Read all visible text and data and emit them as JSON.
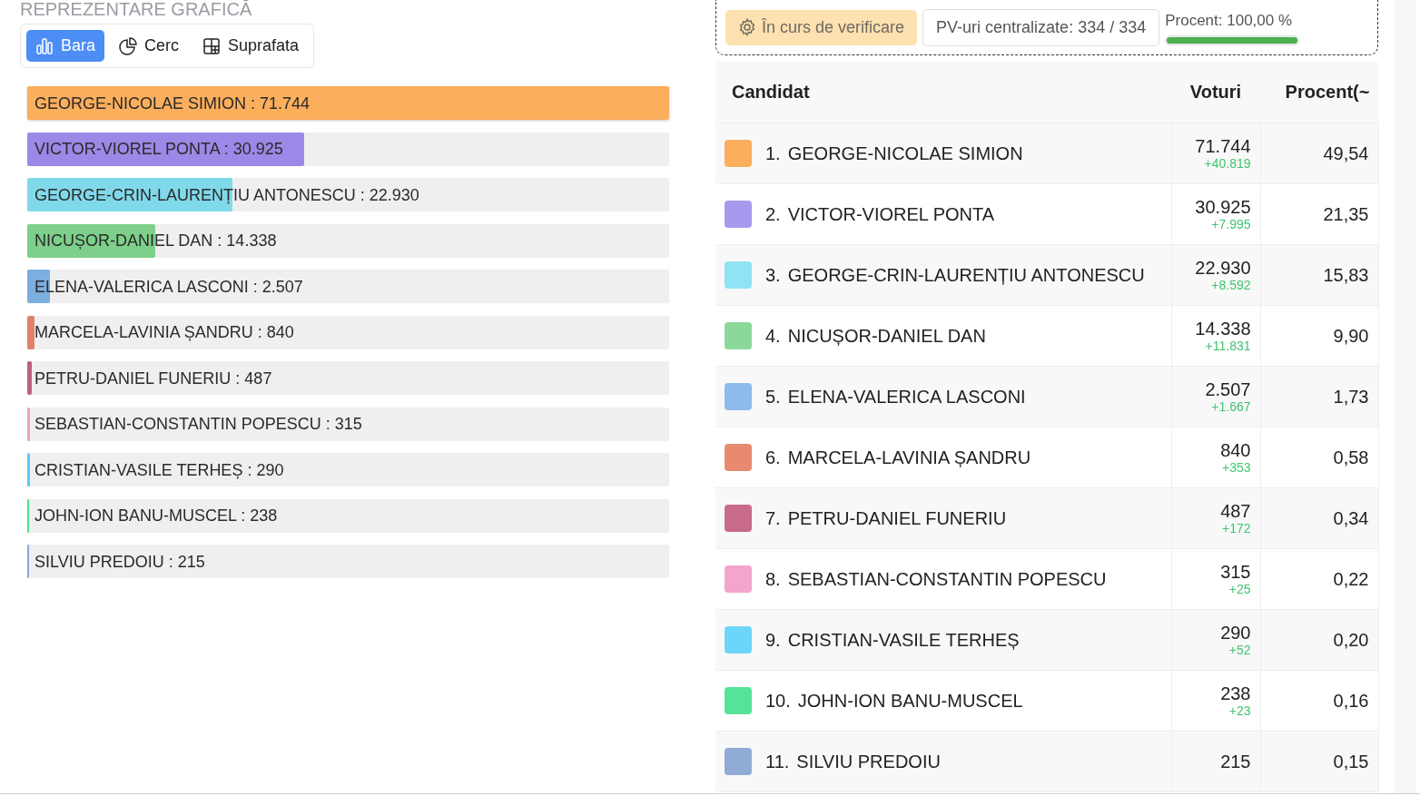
{
  "chart_section": {
    "title": "REPREZENTARE GRAFICĂ",
    "view_tabs": [
      {
        "label": "Bara",
        "kind": "bar",
        "selected": true
      },
      {
        "label": "Cerc",
        "kind": "pie",
        "selected": false
      },
      {
        "label": "Suprafata",
        "kind": "grid",
        "selected": false
      }
    ],
    "bars": [
      {
        "label": "GEORGE-NICOLAE SIMION : 71.744",
        "level": 1,
        "color": "#fbae5c"
      },
      {
        "label": "VICTOR-VIOREL PONTA : 30.925",
        "level": 0.431,
        "color": "#9c88e6"
      },
      {
        "label": "GEORGE-CRIN-LAURENȚIU ANTONESCU : 22.930",
        "level": 0.32,
        "color": "#80d9ea"
      },
      {
        "label": "NICUȘOR-DANIEL DAN : 14.338",
        "level": 0.2,
        "color": "#7dcf8a"
      },
      {
        "label": "ELENA-VALERICA LASCONI : 2.507",
        "level": 0.035,
        "color": "#7daee0"
      },
      {
        "label": "MARCELA-LAVINIA ȘANDRU : 840",
        "level": 0.0117,
        "color": "#e0826a"
      },
      {
        "label": "PETRU-DANIEL FUNERIU : 487",
        "level": 0.0068,
        "color": "#c05f7d"
      },
      {
        "label": "SEBASTIAN-CONSTANTIN POPESCU : 315",
        "level": 0.0044,
        "color": "#ef9cc6"
      },
      {
        "label": "CRISTIAN-VASILE TERHEȘ : 290",
        "level": 0.004,
        "color": "#5ccaf5"
      },
      {
        "label": "JOHN-ION BANU-MUSCEL : 238",
        "level": 0.0033,
        "color": "#4cdf8c"
      },
      {
        "label": "SILVIU PREDOIU : 215",
        "level": 0.003,
        "color": "#8aa9d2"
      }
    ]
  },
  "status": {
    "state_badge": "În curs de verificare",
    "pv_count": "PV-uri centralizate: 334 / 334",
    "progress": {
      "label": "Procent: 100,00 %",
      "level": 1
    }
  },
  "table": {
    "columns": [
      "Candidat",
      "Voturi",
      "Procent(~"
    ],
    "rows": [
      {
        "rank": "1.",
        "name": "GEORGE-NICOLAE SIMION",
        "color": "#fbae5c",
        "votes": "71.744",
        "delta": "+40.819",
        "percent": "49,54"
      },
      {
        "rank": "2.",
        "name": "VICTOR-VIOREL PONTA",
        "color": "#a899ee",
        "votes": "30.925",
        "delta": "+7.995",
        "percent": "21,35"
      },
      {
        "rank": "3.",
        "name": "GEORGE-CRIN-LAURENȚIU ANTONESCU",
        "color": "#8fe3f3",
        "votes": "22.930",
        "delta": "+8.592",
        "percent": "15,83"
      },
      {
        "rank": "4.",
        "name": "NICUȘOR-DANIEL DAN",
        "color": "#8bd99a",
        "votes": "14.338",
        "delta": "+11.831",
        "percent": "9,90"
      },
      {
        "rank": "5.",
        "name": "ELENA-VALERICA LASCONI",
        "color": "#8cbbec",
        "votes": "2.507",
        "delta": "+1.667",
        "percent": "1,73"
      },
      {
        "rank": "6.",
        "name": "MARCELA-LAVINIA ȘANDRU",
        "color": "#e88a70",
        "votes": "840",
        "delta": "+353",
        "percent": "0,58"
      },
      {
        "rank": "7.",
        "name": "PETRU-DANIEL FUNERIU",
        "color": "#c86a89",
        "votes": "487",
        "delta": "+172",
        "percent": "0,34"
      },
      {
        "rank": "8.",
        "name": "SEBASTIAN-CONSTANTIN POPESCU",
        "color": "#f4a5cc",
        "votes": "315",
        "delta": "+25",
        "percent": "0,22"
      },
      {
        "rank": "9.",
        "name": "CRISTIAN-VASILE TERHEȘ",
        "color": "#6dd5fa",
        "votes": "290",
        "delta": "+52",
        "percent": "0,20"
      },
      {
        "rank": "10.",
        "name": "JOHN-ION BANU-MUSCEL",
        "color": "#55e39a",
        "votes": "238",
        "delta": "+23",
        "percent": "0,16"
      },
      {
        "rank": "11.",
        "name": "SILVIU PREDOIU",
        "color": "#90acd4",
        "votes": "215",
        "percent": "0,15"
      }
    ]
  }
}
